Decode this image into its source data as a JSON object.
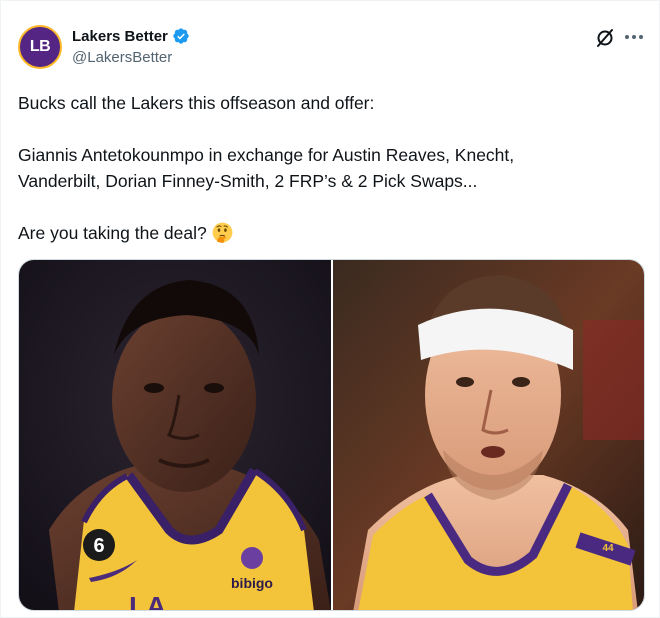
{
  "author": {
    "avatar_text": "LB",
    "display_name": "Lakers Better",
    "handle": "@LakersBetter",
    "verified": true
  },
  "tweet": {
    "line1": "Bucks call the Lakers this offseason and offer:",
    "line2": "Giannis Antetokounmpo in exchange for Austin Reaves, Knecht,",
    "line3": "Vanderbilt, Dorian Finney-Smith, 2 FRP’s & 2 Pick Swaps...",
    "line4": "Are you taking the deal?",
    "emoji": "thinking-face-emoji"
  },
  "media": {
    "photo_left": {
      "jersey_number": "6",
      "sponsor": "bibigo",
      "team_text": "LA"
    },
    "photo_right": {
      "jersey_number": "44"
    }
  },
  "colors": {
    "lakers_purple": "#552583",
    "lakers_gold": "#fdb927",
    "verified_blue": "#1d9bf0",
    "text_primary": "#0f1419",
    "text_secondary": "#536471"
  },
  "icons": [
    "verified-badge-icon",
    "grok-icon",
    "more-icon",
    "thinking-face-emoji"
  ]
}
